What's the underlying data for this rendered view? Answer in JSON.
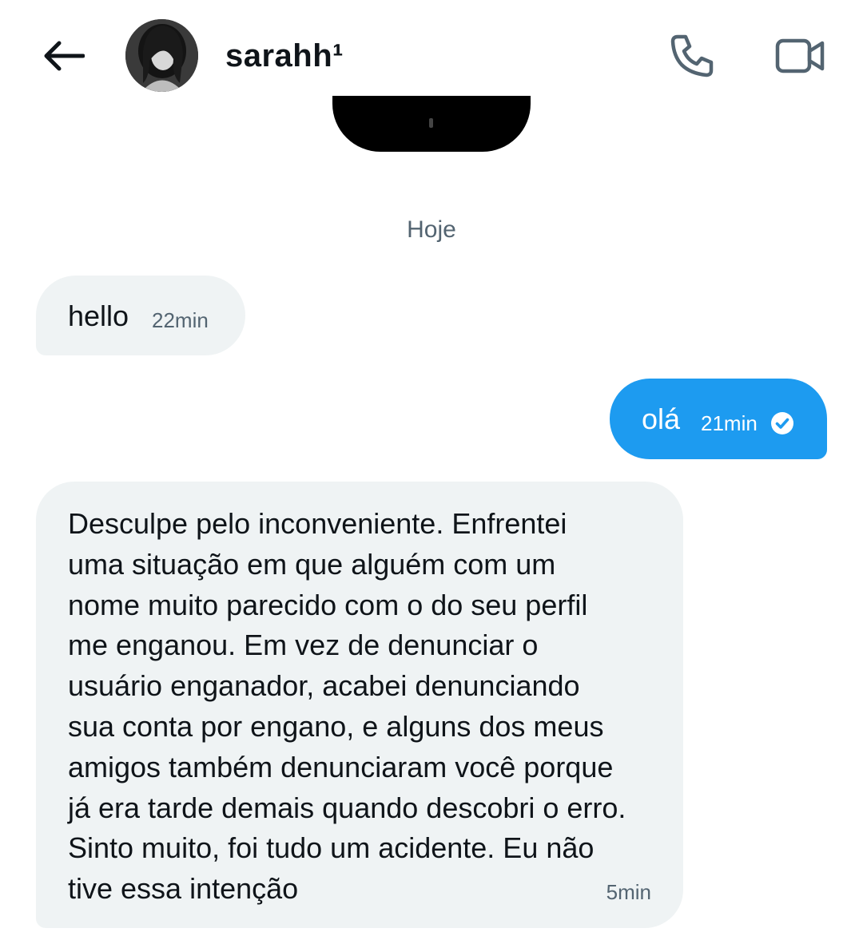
{
  "header": {
    "contact_name": "sarahh¹",
    "icons": {
      "back": "arrow-left-icon",
      "call": "phone-icon",
      "video": "video-camera-icon",
      "verified": "check-circle-icon"
    }
  },
  "date_separator": "Hoje",
  "messages": [
    {
      "direction": "incoming",
      "text": "hello",
      "time": "22min"
    },
    {
      "direction": "outgoing",
      "text": "olá",
      "time": "21min"
    },
    {
      "direction": "incoming",
      "text": "Desculpe pelo inconveniente. Enfrentei\numa situação em que alguém com um\nnome muito parecido com o do seu perfil\nme enganou. Em vez de denunciar o\nusuário enganador, acabei denunciando\nsua conta por engano, e alguns dos meus\namigos também denunciaram você porque\njá era tarde demais quando descobri o erro.\nSinto muito, foi tudo um acidente. Eu não\ntive essa intenção",
      "time": "5min"
    }
  ],
  "colors": {
    "accent": "#1d9bf0",
    "incoming_bubble": "#eff3f4",
    "text_primary": "#0f1419",
    "text_secondary": "#536471",
    "icon_gray": "#536471"
  }
}
